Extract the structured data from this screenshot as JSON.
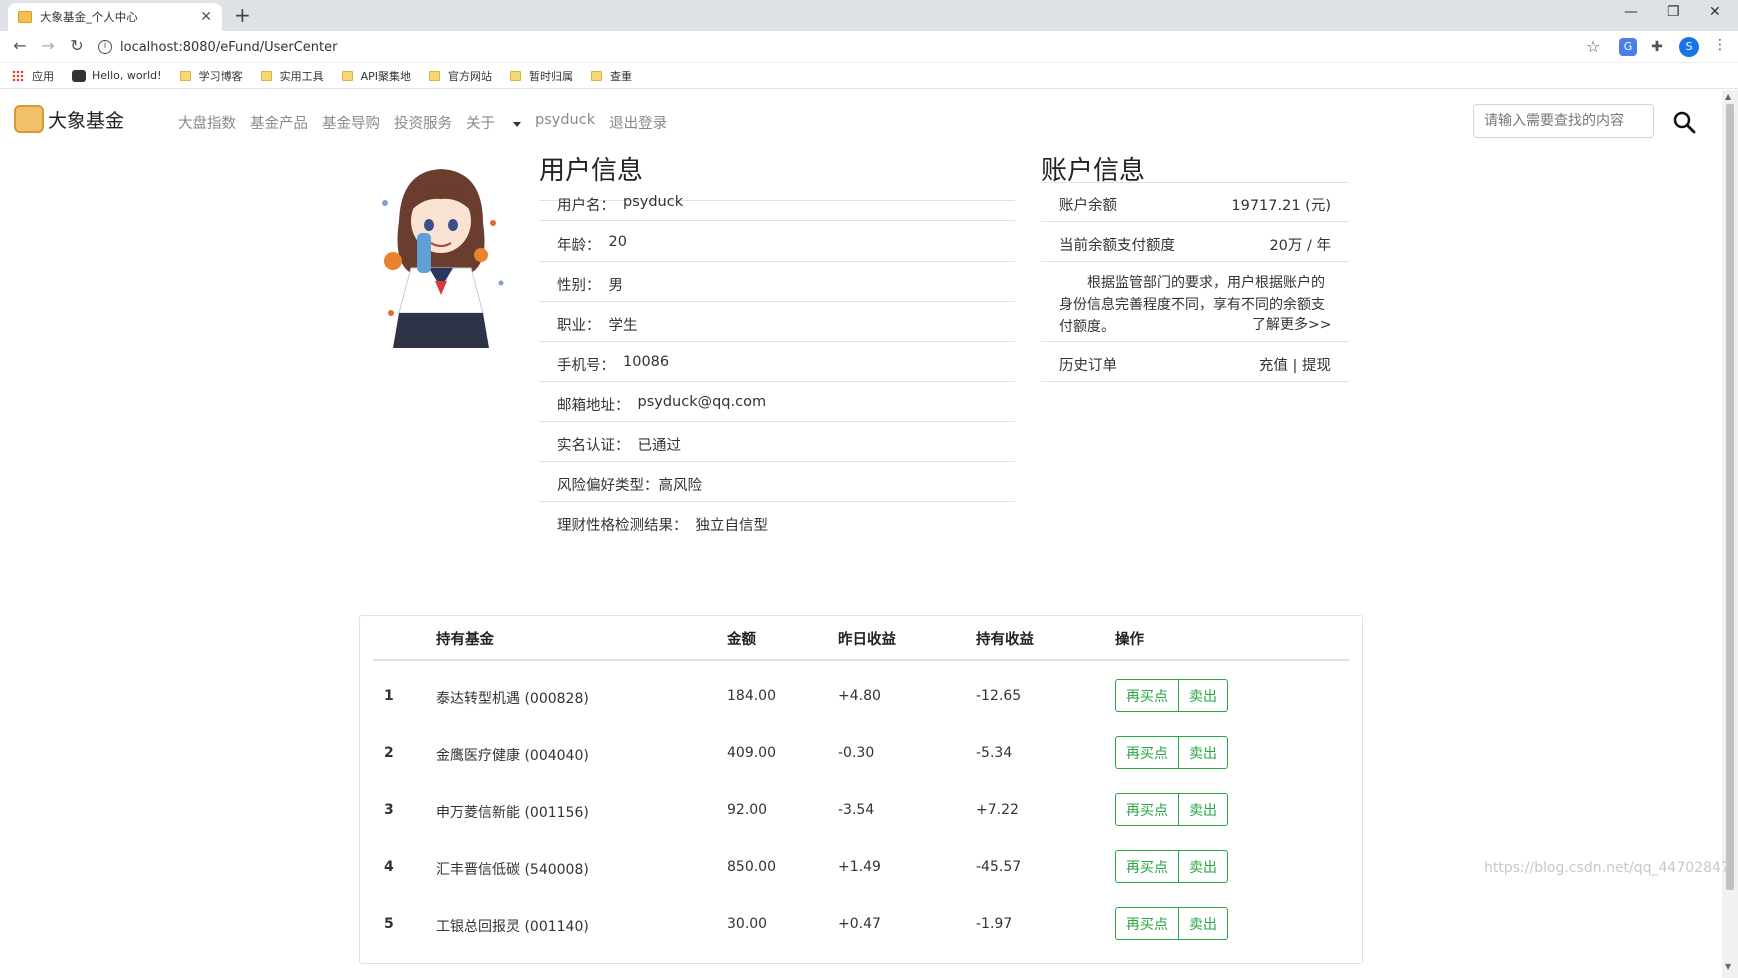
{
  "browser": {
    "tab_title": "大象基金_个人中心",
    "url": "localhost:8080/eFund/UserCenter",
    "profile_initial": "S",
    "bookmarks": [
      "应用",
      "Hello, world!",
      "学习博客",
      "实用工具",
      "API聚集地",
      "官方网站",
      "暂时归属",
      "查重"
    ]
  },
  "nav": {
    "brand": "大象基金",
    "links": [
      "大盘指数",
      "基金产品",
      "基金导购",
      "投资服务"
    ],
    "about": "关于",
    "username": "psyduck",
    "logout": "退出登录",
    "search_placeholder": "请输入需要查找的内容"
  },
  "user": {
    "title": "用户信息",
    "fields": [
      {
        "label": "用户名：",
        "value": "psyduck"
      },
      {
        "label": "年龄：",
        "value": "20"
      },
      {
        "label": "性别：",
        "value": "男"
      },
      {
        "label": "职业：",
        "value": "学生"
      },
      {
        "label": "手机号：",
        "value": "10086"
      },
      {
        "label": "邮箱地址：",
        "value": "psyduck@qq.com"
      },
      {
        "label": "实名认证：",
        "value": "已通过"
      },
      {
        "label": "风险偏好类型：",
        "value": "高风险"
      },
      {
        "label": "理财性格检测结果：",
        "value": "独立自信型"
      }
    ]
  },
  "account": {
    "title": "账户信息",
    "balance_label": "账户余额",
    "balance_value": "19717.21 (元)",
    "limit_label": "当前余额支付额度",
    "limit_value": "20万 / 年",
    "note": "根据监管部门的要求，用户根据账户的身份信息完善程度不同，享有不同的余额支付额度。",
    "learn_more": "了解更多>>",
    "history_label": "历史订单",
    "recharge": "充值",
    "separator": "|",
    "withdraw": "提现"
  },
  "holdings": {
    "headers": [
      "持有基金",
      "金额",
      "昨日收益",
      "持有收益",
      "操作"
    ],
    "rows": [
      {
        "no": "1",
        "fund": "泰达转型机遇 (000828)",
        "amount": "184.00",
        "yesterday": "+4.80",
        "total": "-12.65"
      },
      {
        "no": "2",
        "fund": "金鹰医疗健康 (004040)",
        "amount": "409.00",
        "yesterday": "-0.30",
        "total": "-5.34"
      },
      {
        "no": "3",
        "fund": "申万菱信新能 (001156)",
        "amount": "92.00",
        "yesterday": "-3.54",
        "total": "+7.22"
      },
      {
        "no": "4",
        "fund": "汇丰晋信低碳 (540008)",
        "amount": "850.00",
        "yesterday": "+1.49",
        "total": "-45.57"
      },
      {
        "no": "5",
        "fund": "工银总回报灵 (001140)",
        "amount": "30.00",
        "yesterday": "+0.47",
        "total": "-1.97"
      }
    ],
    "buy_label": "再买点",
    "sell_label": "卖出"
  },
  "watermark": "https://blog.csdn.net/qq_44702847"
}
